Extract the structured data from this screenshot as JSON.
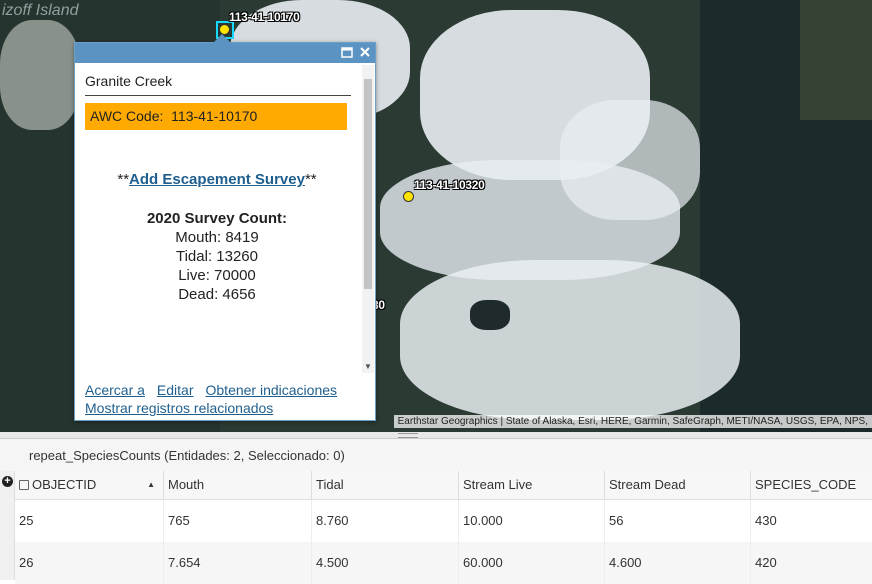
{
  "map": {
    "island_label": "izoff Island",
    "points": [
      {
        "label": "113-41-10170",
        "selected": true
      },
      {
        "label": "113-41-10320",
        "selected": false
      }
    ],
    "partial_label": "30",
    "attribution": "Earthstar Geographics | State of Alaska, Esri, HERE, Garmin, SafeGraph, METI/NASA, USGS, EPA, NPS,"
  },
  "popup": {
    "maximize_icon": "maximize-icon",
    "close_icon": "close-icon",
    "title": "Granite Creek",
    "awc_label": "AWC Code:",
    "awc_value": "113-41-10170",
    "survey_prefix": "**",
    "survey_link": "Add Escapement Survey",
    "survey_suffix": "**",
    "counts_heading": "2020 Survey Count:",
    "counts": [
      {
        "text": "Mouth: 8419"
      },
      {
        "text": "Tidal: 13260"
      },
      {
        "text": "Live: 70000"
      },
      {
        "text": "Dead: 4656"
      }
    ],
    "actions": [
      "Acercar a",
      "Editar",
      "Obtener indicaciones",
      "Mostrar registros relacionados"
    ],
    "accent_color": "#5b94c3",
    "awc_color": "#ffaa00"
  },
  "table": {
    "title": "repeat_SpeciesCounts (Entidades: 2, Seleccionado: 0)",
    "add_icon": "plus-circle-icon",
    "columns": [
      "OBJECTID",
      "Mouth",
      "Tidal",
      "Stream Live",
      "Stream Dead",
      "SPECIES_CODE"
    ],
    "rows": [
      [
        "25",
        "765",
        "8.760",
        "10.000",
        "56",
        "430"
      ],
      [
        "26",
        "7.654",
        "4.500",
        "60.000",
        "4.600",
        "420"
      ]
    ]
  }
}
